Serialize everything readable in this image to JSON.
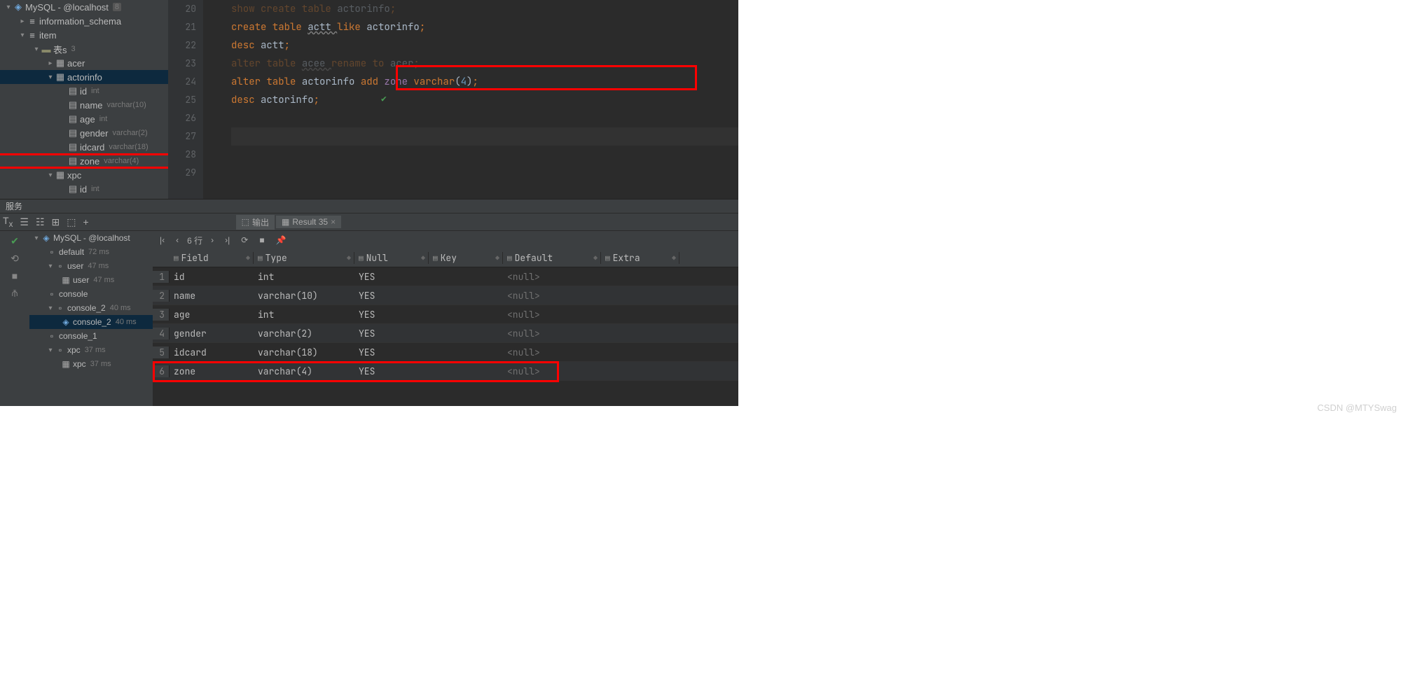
{
  "watermark": "CSDN @MTYSwag",
  "tree": {
    "conn": "MySQL - @localhost",
    "conn_badge": "8",
    "info_schema": "information_schema",
    "item": "item",
    "tables_label": "表s",
    "tables_count": "3",
    "tbl_acer": "acer",
    "tbl_actorinfo": "actorinfo",
    "tbl_xpc": "xpc",
    "cols": {
      "id": {
        "n": "id",
        "t": "int"
      },
      "name": {
        "n": "name",
        "t": "varchar(10)"
      },
      "age": {
        "n": "age",
        "t": "int"
      },
      "gender": {
        "n": "gender",
        "t": "varchar(2)"
      },
      "idcard": {
        "n": "idcard",
        "t": "varchar(18)"
      },
      "zone": {
        "n": "zone",
        "t": "varchar(4)"
      },
      "xpc_id": {
        "n": "id",
        "t": "int"
      }
    }
  },
  "gutter": [
    "20",
    "21",
    "22",
    "23",
    "24",
    "25",
    "26",
    "27",
    "28",
    "29"
  ],
  "code": {
    "l20": {
      "a": "show create table ",
      "b": "actorinfo",
      "c": ";"
    },
    "l21": {
      "a": "create table ",
      "b": "actt ",
      "c": "like ",
      "d": "actorinfo",
      "e": ";"
    },
    "l22": {
      "a": "desc ",
      "b": "actt",
      "c": ";"
    },
    "l23": {
      "a": "alter table ",
      "b": "acee ",
      "c": "rename to ",
      "d": "acer",
      "e": ";"
    },
    "l24": {
      "a": "alter table ",
      "b": "actorinfo ",
      "c": "add ",
      "d": "zone ",
      "e": "varchar",
      "f": "(",
      "g": "4",
      "h": ")",
      "i": ";"
    },
    "l25": {
      "a": "desc ",
      "b": "actorinfo",
      "c": ";"
    }
  },
  "services_label": "服务",
  "tabs": {
    "output": "输出",
    "result": "Result 35"
  },
  "result_tb": {
    "rows": "6 行"
  },
  "svc": {
    "conn": "MySQL - @localhost",
    "default": {
      "n": "default",
      "t": "72 ms"
    },
    "user": {
      "n": "user",
      "t": "47 ms"
    },
    "user_inner": {
      "n": "user",
      "t": "47 ms"
    },
    "console": "console",
    "console2": {
      "n": "console_2",
      "t": "40 ms"
    },
    "console2_inner": {
      "n": "console_2",
      "t": "40 ms"
    },
    "console1": "console_1",
    "xpc": {
      "n": "xpc",
      "t": "37 ms"
    },
    "xpc_inner": {
      "n": "xpc",
      "t": "37 ms"
    }
  },
  "grid": {
    "headers": {
      "field": "Field",
      "type": "Type",
      "null": "Null",
      "key": "Key",
      "def": "Default",
      "extra": "Extra"
    },
    "rows": [
      {
        "n": "1",
        "field": "id",
        "type": "int",
        "null": "YES",
        "key": "",
        "def": "<null>",
        "extra": ""
      },
      {
        "n": "2",
        "field": "name",
        "type": "varchar(10)",
        "null": "YES",
        "key": "",
        "def": "<null>",
        "extra": ""
      },
      {
        "n": "3",
        "field": "age",
        "type": "int",
        "null": "YES",
        "key": "",
        "def": "<null>",
        "extra": ""
      },
      {
        "n": "4",
        "field": "gender",
        "type": "varchar(2)",
        "null": "YES",
        "key": "",
        "def": "<null>",
        "extra": ""
      },
      {
        "n": "5",
        "field": "idcard",
        "type": "varchar(18)",
        "null": "YES",
        "key": "",
        "def": "<null>",
        "extra": ""
      },
      {
        "n": "6",
        "field": "zone",
        "type": "varchar(4)",
        "null": "YES",
        "key": "",
        "def": "<null>",
        "extra": ""
      }
    ]
  }
}
